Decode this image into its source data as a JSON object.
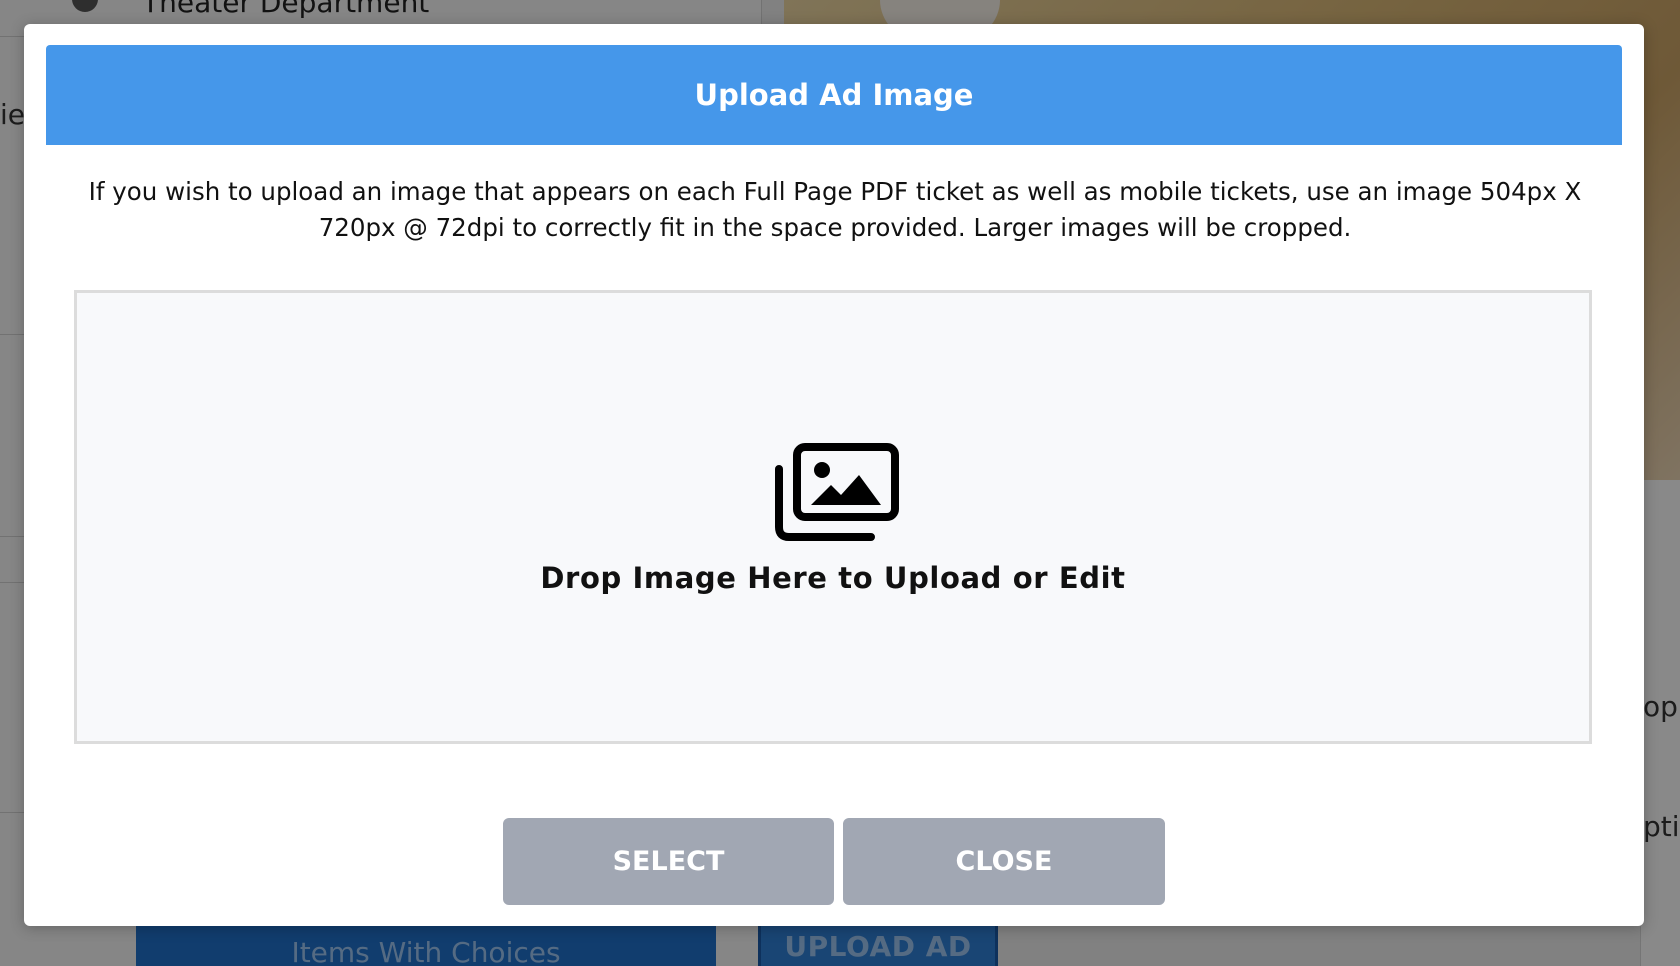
{
  "background": {
    "heading": "Theater Department",
    "left_edge_text": "ie",
    "right_edge_texts": [
      "op",
      "pti"
    ],
    "buttons": {
      "items_with_choices": "Items With Choices",
      "upload_ad": "UPLOAD AD"
    }
  },
  "modal": {
    "title": "Upload Ad Image",
    "description": "If you wish to upload an image that appears on each Full Page PDF ticket as well as mobile tickets, use an image 504px X 720px @ 72dpi to correctly fit in the space provided. Larger images will be cropped.",
    "dropzone": {
      "icon": "images-icon",
      "label": "Drop Image Here to Upload or Edit"
    },
    "buttons": {
      "select": "SELECT",
      "close": "CLOSE"
    }
  },
  "colors": {
    "header": "#4597ea",
    "button": "#a1a7b3",
    "dropzone_bg": "#f8f9fb",
    "dropzone_border": "#dcdcdc",
    "background_button": "#1f6fc8"
  }
}
